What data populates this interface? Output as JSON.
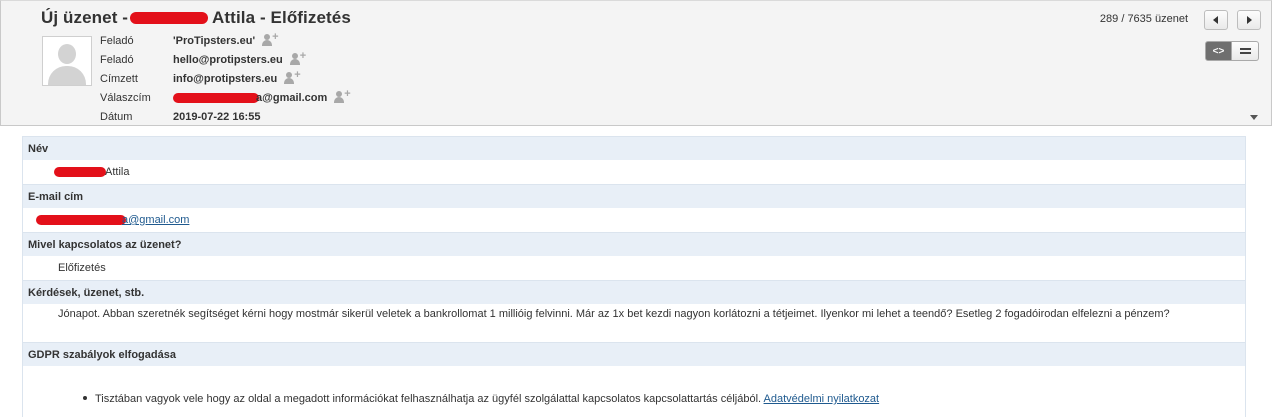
{
  "message": {
    "subject_prefix": "Új üzenet -",
    "subject_suffix": "Attila - Előfizetés",
    "counter": "289 / 7635 üzenet"
  },
  "headers": [
    {
      "label": "Feladó",
      "value": "'ProTipsters.eu'"
    },
    {
      "label": "Feladó",
      "value": "hello@protipsters.eu"
    },
    {
      "label": "Címzett",
      "value": "info@protipsters.eu"
    },
    {
      "label": "Válaszcím",
      "value": "a@gmail.com"
    },
    {
      "label": "Dátum",
      "value": "2019-07-22 16:55"
    }
  ],
  "view_toggle": {
    "html_label": "<>"
  },
  "form": {
    "name_label": "Név",
    "name_value": "Attila",
    "email_label": "E-mail cím",
    "email_value": "a@gmail.com",
    "topic_label": "Mivel kapcsolatos az üzenet?",
    "topic_value": "Előfizetés",
    "questions_label": "Kérdések, üzenet, stb.",
    "questions_value": "Jónapot. Abban szeretnék segítséget kérni hogy mostmár sikerül veletek a bankrollomat 1 millióig felvinni. Már az 1x bet kezdi nagyon korlátozni a tétjeimet. Ilyenkor mi lehet a teendő? Esetleg 2 fogadóirodan elfelezni a pénzem?",
    "gdpr_label": "GDPR szabályok elfogadása",
    "gdpr_text": "Tisztában vagyok vele hogy az oldal a megadott információkat felhasználhatja az ügyfél szolgálattal kapcsolatos kapcsolattartás céljából.",
    "gdpr_link": "Adatvédelmi nyilatkozat"
  },
  "colors": {
    "redaction": "#e3101a",
    "header_bg": "#f4f4f4",
    "section_bg": "#e8eff7",
    "link": "#1f5a8f"
  }
}
